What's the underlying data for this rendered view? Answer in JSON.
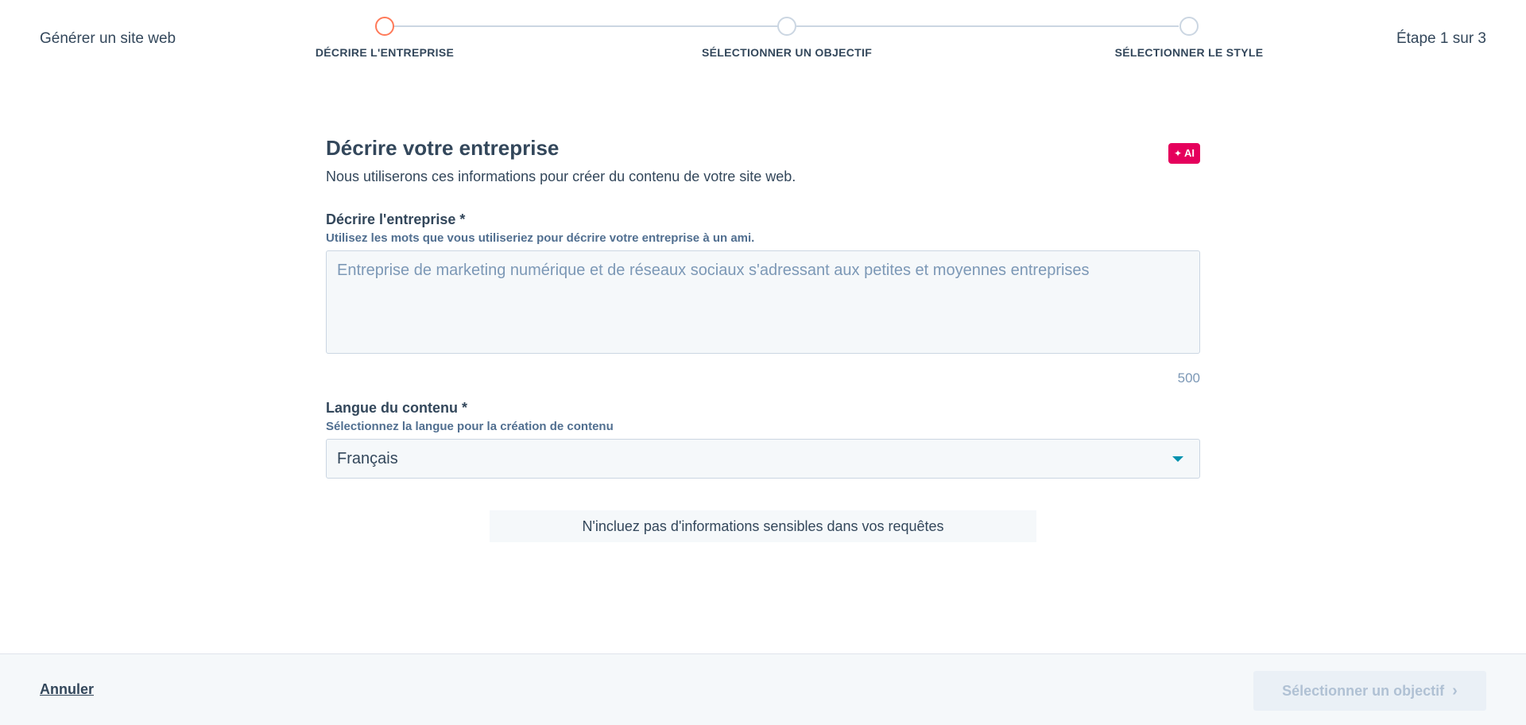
{
  "header": {
    "app_title": "Générer un site web",
    "step_counter": "Étape 1 sur 3",
    "steps": [
      {
        "label": "DÉCRIRE L'ENTREPRISE",
        "state": "active"
      },
      {
        "label": "SÉLECTIONNER UN OBJECTIF",
        "state": "pending"
      },
      {
        "label": "SÉLECTIONNER LE STYLE",
        "state": "pending"
      }
    ]
  },
  "form": {
    "title": "Décrire votre entreprise",
    "ai_badge": "AI",
    "ai_badge_icon": "sparkle-icon",
    "subtitle": "Nous utiliserons ces informations pour créer du contenu de votre site web.",
    "description": {
      "label": "Décrire l'entreprise *",
      "help": "Utilisez les mots que vous utiliseriez pour décrire votre entreprise à un ami.",
      "value": "",
      "placeholder": "Entreprise de marketing numérique et de réseaux sociaux s'adressant aux petites et moyennes entreprises",
      "char_limit": "500"
    },
    "language": {
      "label": "Langue du contenu *",
      "help": "Sélectionnez la langue pour la création de contenu",
      "selected": "Français"
    },
    "notice": "N'incluez pas d'informations sensibles dans vos requêtes"
  },
  "footer": {
    "cancel_label": "Annuler",
    "next_label": "Sélectionner un objectif"
  },
  "colors": {
    "accent_active_step": "#ff7a59",
    "ai_badge": "#e5005c",
    "dropdown_caret": "#0091ae",
    "text_primary": "#33475b"
  }
}
